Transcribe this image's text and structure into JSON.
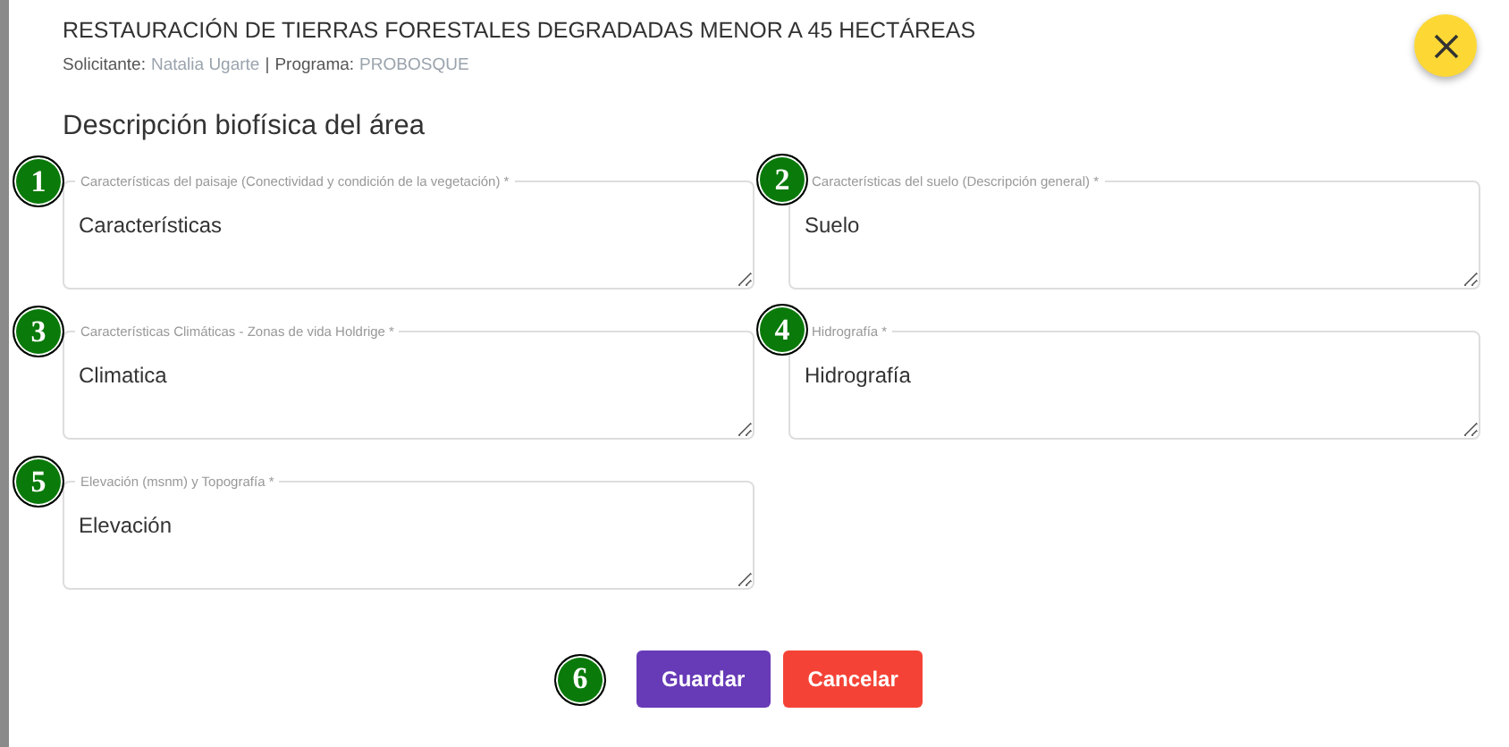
{
  "header": {
    "title": "RESTAURACIÓN DE TIERRAS FORESTALES DEGRADADAS MENOR A 45 HECTÁREAS",
    "applicant_label": "Solicitante:",
    "applicant": "Natalia Ugarte",
    "separator": "|",
    "program_label": "Programa:",
    "program": "PROBOSQUE"
  },
  "section_title": "Descripción biofísica del área",
  "fields": [
    {
      "marker": "1",
      "label": "Características del paisaje (Conectividad y condición de la vegetación) *",
      "value": "Características"
    },
    {
      "marker": "2",
      "label": "Características del suelo (Descripción general) *",
      "value": "Suelo"
    },
    {
      "marker": "3",
      "label": "Características Climáticas - Zonas de vida Holdrige *",
      "value": "Climatica"
    },
    {
      "marker": "4",
      "label": "Hidrografía *",
      "value": "Hidrografía"
    },
    {
      "marker": "5",
      "label": "Elevación (msnm) y Topografía *",
      "value": "Elevación"
    }
  ],
  "actions": {
    "marker": "6",
    "buttons": [
      {
        "label": "Guardar",
        "kind": "primary"
      },
      {
        "label": "Cancelar",
        "kind": "danger"
      }
    ]
  }
}
